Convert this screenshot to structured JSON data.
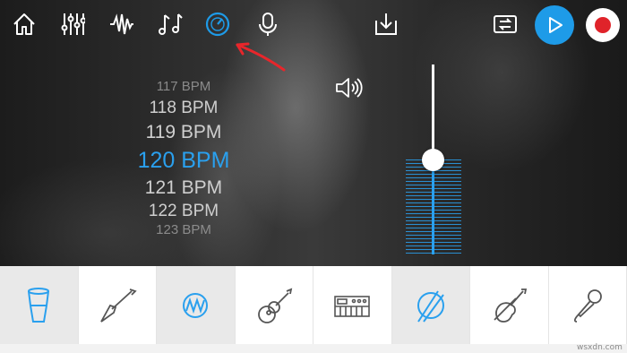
{
  "toolbar": {
    "icons": [
      "home-icon",
      "mixer-icon",
      "waveform-icon",
      "music-notes-icon",
      "tempo-dial-icon",
      "microphone-icon",
      "download-icon",
      "loop-icon",
      "play-icon",
      "record-icon"
    ],
    "active_icon": "tempo-dial-icon",
    "accent_color": "#1e9be8",
    "record_color": "#e0232a"
  },
  "tempo": {
    "values": [
      "117 BPM",
      "118 BPM",
      "119 BPM",
      "120 BPM",
      "121 BPM",
      "122 BPM",
      "123 BPM"
    ],
    "selected": "120 BPM",
    "selected_color": "#2aa0ee"
  },
  "volume": {
    "icon": "speaker-icon",
    "level": 0.5
  },
  "instruments": [
    {
      "icon": "drum-icon",
      "active": true
    },
    {
      "icon": "electric-guitar-icon",
      "active": false
    },
    {
      "icon": "synth-wave-icon",
      "active": true
    },
    {
      "icon": "acoustic-guitar-icon",
      "active": false
    },
    {
      "icon": "keyboard-icon",
      "active": false
    },
    {
      "icon": "drumsticks-icon",
      "active": true
    },
    {
      "icon": "violin-icon",
      "active": false
    },
    {
      "icon": "vocal-mic-icon",
      "active": false
    }
  ],
  "watermark": "wsxdn.com"
}
